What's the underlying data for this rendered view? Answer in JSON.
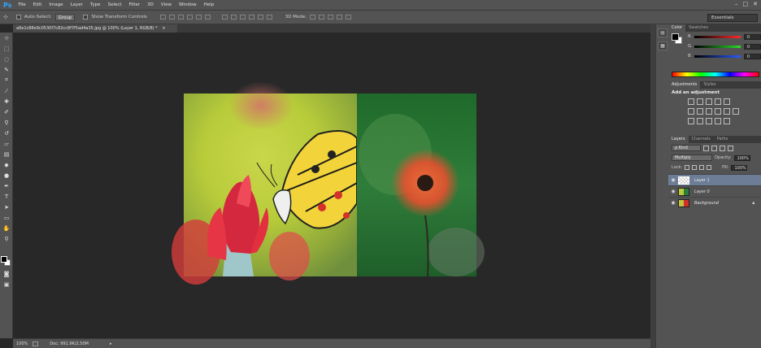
{
  "menubar": {
    "logo": "Ps",
    "items": [
      "File",
      "Edit",
      "Image",
      "Layer",
      "Type",
      "Select",
      "Filter",
      "3D",
      "View",
      "Window",
      "Help"
    ],
    "window_controls": [
      "–",
      "□",
      "✕"
    ]
  },
  "options": {
    "auto_select_label": "Auto-Select:",
    "auto_select_value": "Group",
    "transform_label": "Show Transform Controls",
    "mode_3d_label": "3D Mode:",
    "workspace": "Essentials"
  },
  "document": {
    "tab_title": "a6e1c88e9c0530f7c82cc8f7f5ad4a35.jpg @ 100% (Layer 1, RGB/8) *",
    "tab_close": "×"
  },
  "status": {
    "zoom": "100%",
    "doc_info": "Doc: 991.9K/2.50M"
  },
  "color_panel": {
    "tabs": [
      "Color",
      "Swatches"
    ],
    "channels": [
      {
        "label": "R",
        "value": "0",
        "color": "#ff2a2a"
      },
      {
        "label": "G",
        "value": "0",
        "color": "#2adc2a"
      },
      {
        "label": "B",
        "value": "0",
        "color": "#2a5aff"
      }
    ]
  },
  "adjustments_panel": {
    "tabs": [
      "Adjustments",
      "Styles"
    ],
    "title": "Add an adjustment"
  },
  "layers_panel": {
    "tabs": [
      "Layers",
      "Channels",
      "Paths"
    ],
    "kind_label": "ρ Kind",
    "blend_mode": "Multiply",
    "opacity_label": "Opacity:",
    "opacity_value": "100%",
    "lock_label": "Lock:",
    "fill_label": "Fill:",
    "fill_value": "100%",
    "layers": [
      {
        "name": "Layer 1",
        "selected": true
      },
      {
        "name": "Layer 0",
        "selected": false
      },
      {
        "name": "Background",
        "selected": false
      }
    ]
  },
  "colors": {
    "accent": "#31a8ff",
    "selected_layer": "#6d7d96",
    "panel_bg": "#535353",
    "canvas_bg": "#282828"
  }
}
